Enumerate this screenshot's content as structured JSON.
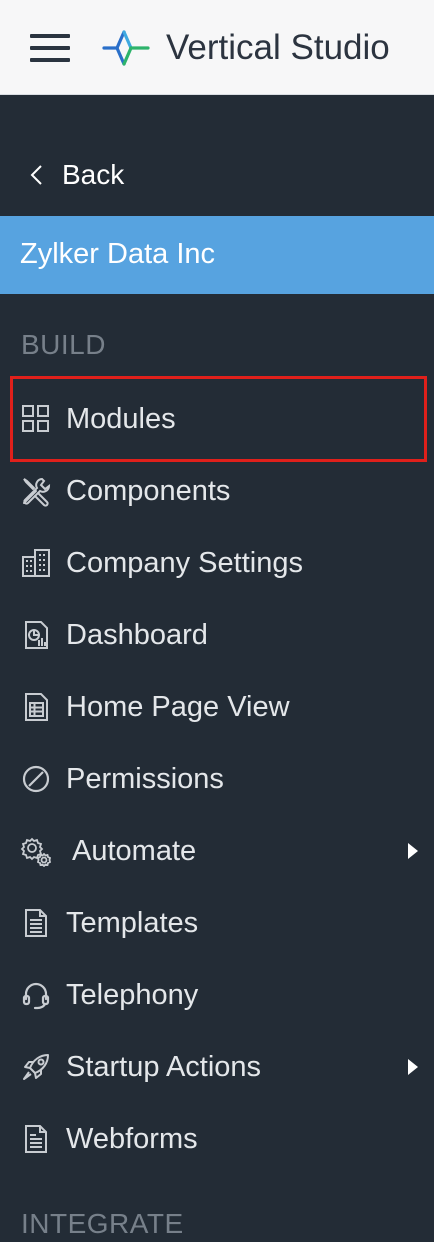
{
  "header": {
    "app_title": "Vertical Studio",
    "menu_icon": "hamburger-icon",
    "logo_icon": "sparkle-logo-icon"
  },
  "nav": {
    "back_label": "Back",
    "org_name": "Zylker Data Inc",
    "sections": [
      {
        "title": "BUILD"
      },
      {
        "title": "INTEGRATE"
      }
    ],
    "items": [
      {
        "label": "Modules",
        "icon": "modules-icon",
        "selected_outline": true
      },
      {
        "label": "Components",
        "icon": "tools-icon"
      },
      {
        "label": "Company Settings",
        "icon": "building-icon"
      },
      {
        "label": "Dashboard",
        "icon": "dashboard-report-icon"
      },
      {
        "label": "Home Page View",
        "icon": "page-layout-icon"
      },
      {
        "label": "Permissions",
        "icon": "permissions-icon"
      },
      {
        "label": "Automate",
        "icon": "gears-icon",
        "has_submenu": true
      },
      {
        "label": "Templates",
        "icon": "document-icon"
      },
      {
        "label": "Telephony",
        "icon": "headset-icon"
      },
      {
        "label": "Startup Actions",
        "icon": "rocket-icon",
        "has_submenu": true
      },
      {
        "label": "Webforms",
        "icon": "form-icon"
      }
    ]
  },
  "colors": {
    "sidebar_bg": "#232c36",
    "org_bg": "#57a3e0",
    "highlight": "#e0201b",
    "topbar_bg": "#f7f7f8"
  }
}
